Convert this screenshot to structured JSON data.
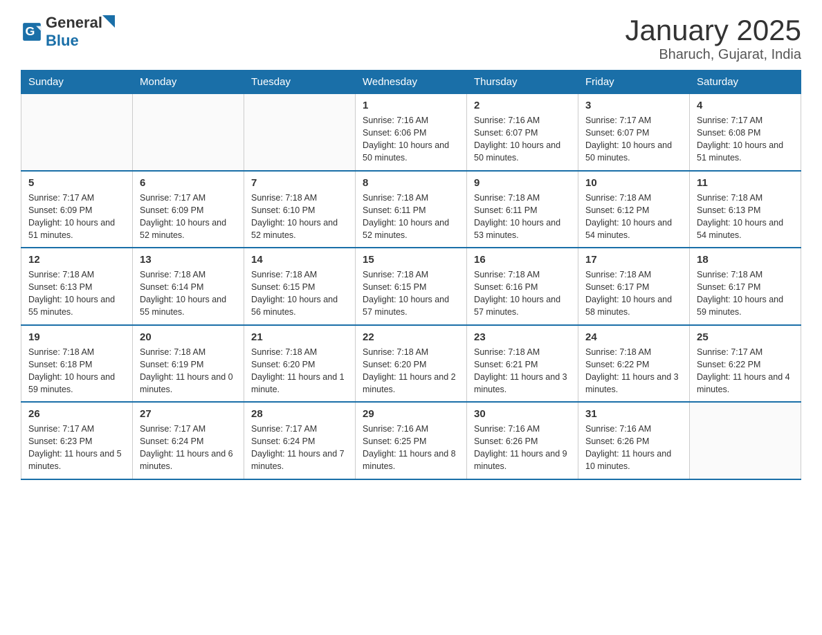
{
  "header": {
    "logo_general": "General",
    "logo_blue": "Blue",
    "title": "January 2025",
    "subtitle": "Bharuch, Gujarat, India"
  },
  "days_of_week": [
    "Sunday",
    "Monday",
    "Tuesday",
    "Wednesday",
    "Thursday",
    "Friday",
    "Saturday"
  ],
  "weeks": [
    {
      "days": [
        {
          "number": "",
          "info": ""
        },
        {
          "number": "",
          "info": ""
        },
        {
          "number": "",
          "info": ""
        },
        {
          "number": "1",
          "info": "Sunrise: 7:16 AM\nSunset: 6:06 PM\nDaylight: 10 hours\nand 50 minutes."
        },
        {
          "number": "2",
          "info": "Sunrise: 7:16 AM\nSunset: 6:07 PM\nDaylight: 10 hours\nand 50 minutes."
        },
        {
          "number": "3",
          "info": "Sunrise: 7:17 AM\nSunset: 6:07 PM\nDaylight: 10 hours\nand 50 minutes."
        },
        {
          "number": "4",
          "info": "Sunrise: 7:17 AM\nSunset: 6:08 PM\nDaylight: 10 hours\nand 51 minutes."
        }
      ]
    },
    {
      "days": [
        {
          "number": "5",
          "info": "Sunrise: 7:17 AM\nSunset: 6:09 PM\nDaylight: 10 hours\nand 51 minutes."
        },
        {
          "number": "6",
          "info": "Sunrise: 7:17 AM\nSunset: 6:09 PM\nDaylight: 10 hours\nand 52 minutes."
        },
        {
          "number": "7",
          "info": "Sunrise: 7:18 AM\nSunset: 6:10 PM\nDaylight: 10 hours\nand 52 minutes."
        },
        {
          "number": "8",
          "info": "Sunrise: 7:18 AM\nSunset: 6:11 PM\nDaylight: 10 hours\nand 52 minutes."
        },
        {
          "number": "9",
          "info": "Sunrise: 7:18 AM\nSunset: 6:11 PM\nDaylight: 10 hours\nand 53 minutes."
        },
        {
          "number": "10",
          "info": "Sunrise: 7:18 AM\nSunset: 6:12 PM\nDaylight: 10 hours\nand 54 minutes."
        },
        {
          "number": "11",
          "info": "Sunrise: 7:18 AM\nSunset: 6:13 PM\nDaylight: 10 hours\nand 54 minutes."
        }
      ]
    },
    {
      "days": [
        {
          "number": "12",
          "info": "Sunrise: 7:18 AM\nSunset: 6:13 PM\nDaylight: 10 hours\nand 55 minutes."
        },
        {
          "number": "13",
          "info": "Sunrise: 7:18 AM\nSunset: 6:14 PM\nDaylight: 10 hours\nand 55 minutes."
        },
        {
          "number": "14",
          "info": "Sunrise: 7:18 AM\nSunset: 6:15 PM\nDaylight: 10 hours\nand 56 minutes."
        },
        {
          "number": "15",
          "info": "Sunrise: 7:18 AM\nSunset: 6:15 PM\nDaylight: 10 hours\nand 57 minutes."
        },
        {
          "number": "16",
          "info": "Sunrise: 7:18 AM\nSunset: 6:16 PM\nDaylight: 10 hours\nand 57 minutes."
        },
        {
          "number": "17",
          "info": "Sunrise: 7:18 AM\nSunset: 6:17 PM\nDaylight: 10 hours\nand 58 minutes."
        },
        {
          "number": "18",
          "info": "Sunrise: 7:18 AM\nSunset: 6:17 PM\nDaylight: 10 hours\nand 59 minutes."
        }
      ]
    },
    {
      "days": [
        {
          "number": "19",
          "info": "Sunrise: 7:18 AM\nSunset: 6:18 PM\nDaylight: 10 hours\nand 59 minutes."
        },
        {
          "number": "20",
          "info": "Sunrise: 7:18 AM\nSunset: 6:19 PM\nDaylight: 11 hours\nand 0 minutes."
        },
        {
          "number": "21",
          "info": "Sunrise: 7:18 AM\nSunset: 6:20 PM\nDaylight: 11 hours\nand 1 minute."
        },
        {
          "number": "22",
          "info": "Sunrise: 7:18 AM\nSunset: 6:20 PM\nDaylight: 11 hours\nand 2 minutes."
        },
        {
          "number": "23",
          "info": "Sunrise: 7:18 AM\nSunset: 6:21 PM\nDaylight: 11 hours\nand 3 minutes."
        },
        {
          "number": "24",
          "info": "Sunrise: 7:18 AM\nSunset: 6:22 PM\nDaylight: 11 hours\nand 3 minutes."
        },
        {
          "number": "25",
          "info": "Sunrise: 7:17 AM\nSunset: 6:22 PM\nDaylight: 11 hours\nand 4 minutes."
        }
      ]
    },
    {
      "days": [
        {
          "number": "26",
          "info": "Sunrise: 7:17 AM\nSunset: 6:23 PM\nDaylight: 11 hours\nand 5 minutes."
        },
        {
          "number": "27",
          "info": "Sunrise: 7:17 AM\nSunset: 6:24 PM\nDaylight: 11 hours\nand 6 minutes."
        },
        {
          "number": "28",
          "info": "Sunrise: 7:17 AM\nSunset: 6:24 PM\nDaylight: 11 hours\nand 7 minutes."
        },
        {
          "number": "29",
          "info": "Sunrise: 7:16 AM\nSunset: 6:25 PM\nDaylight: 11 hours\nand 8 minutes."
        },
        {
          "number": "30",
          "info": "Sunrise: 7:16 AM\nSunset: 6:26 PM\nDaylight: 11 hours\nand 9 minutes."
        },
        {
          "number": "31",
          "info": "Sunrise: 7:16 AM\nSunset: 6:26 PM\nDaylight: 11 hours\nand 10 minutes."
        },
        {
          "number": "",
          "info": ""
        }
      ]
    }
  ]
}
